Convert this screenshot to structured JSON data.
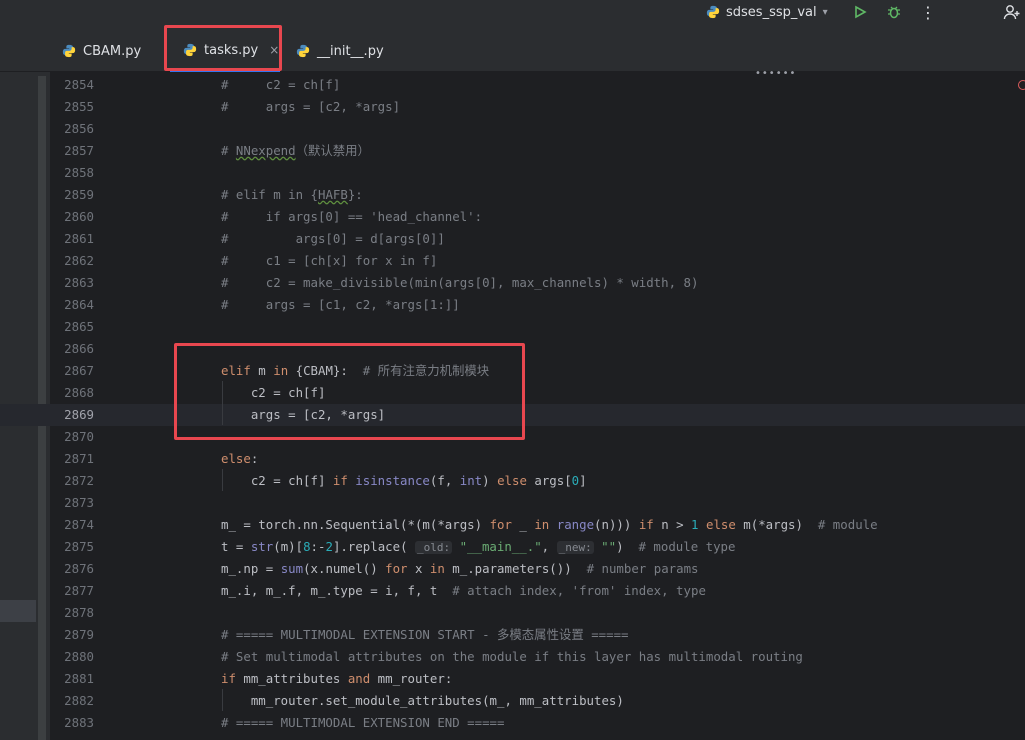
{
  "toolbar": {
    "run_config": "sdses_ssp_val",
    "run_config_chevron": "chevron-down-icon"
  },
  "tabs": [
    {
      "label": "CBAM.py",
      "icon": "python-file-icon"
    },
    {
      "label": "tasks.py",
      "icon": "python-file-icon",
      "active": true,
      "close": "×"
    },
    {
      "label": "__init__.py",
      "icon": "python-file-icon"
    }
  ],
  "editor": {
    "current_line": "2869",
    "lines": [
      {
        "n": "2854",
        "t": "#     c2 = ch[f]"
      },
      {
        "n": "2855",
        "t": "#     args = [c2, *args]"
      },
      {
        "n": "2856",
        "t": ""
      },
      {
        "n": "2857",
        "t": "# NNexpend（默认禁用）"
      },
      {
        "n": "2858",
        "t": ""
      },
      {
        "n": "2859",
        "t": "# elif m in {HAFB}:"
      },
      {
        "n": "2860",
        "t": "#     if args[0] == 'head_channel':"
      },
      {
        "n": "2861",
        "t": "#         args[0] = d[args[0]]"
      },
      {
        "n": "2862",
        "t": "#     c1 = [ch[x] for x in f]"
      },
      {
        "n": "2863",
        "t": "#     c2 = make_divisible(min(args[0], max_channels) * width, 8)"
      },
      {
        "n": "2864",
        "t": "#     args = [c1, c2, *args[1:]]"
      },
      {
        "n": "2865",
        "t": ""
      },
      {
        "n": "2866",
        "t": ""
      },
      {
        "n": "2867",
        "t": "elif m in {CBAM}:  # 所有注意力机制模块"
      },
      {
        "n": "2868",
        "t": "    c2 = ch[f]"
      },
      {
        "n": "2869",
        "t": "    args = [c2, *args]"
      },
      {
        "n": "2870",
        "t": ""
      },
      {
        "n": "2871",
        "t": "else:"
      },
      {
        "n": "2872",
        "t": "    c2 = ch[f] if isinstance(f, int) else args[0]"
      },
      {
        "n": "2873",
        "t": ""
      },
      {
        "n": "2874",
        "t": "m_ = torch.nn.Sequential(*(m(*args) for _ in range(n))) if n > 1 else m(*args)  # module"
      },
      {
        "n": "2875",
        "t": "t = str(m)[8:-2].replace( _old: \"__main__.\", _new: \"\")  # module type"
      },
      {
        "n": "2876",
        "t": "m_.np = sum(x.numel() for x in m_.parameters())  # number params"
      },
      {
        "n": "2877",
        "t": "m_.i, m_.f, m_.type = i, f, t  # attach index, 'from' index, type"
      },
      {
        "n": "2878",
        "t": ""
      },
      {
        "n": "2879",
        "t": "# ===== MULTIMODAL EXTENSION START - 多模态属性设置 ====="
      },
      {
        "n": "2880",
        "t": "# Set multimodal attributes on the module if this layer has multimodal routing"
      },
      {
        "n": "2881",
        "t": "if mm_attributes and mm_router:"
      },
      {
        "n": "2882",
        "t": "    mm_router.set_module_attributes(m_, mm_attributes)"
      },
      {
        "n": "2883",
        "t": "# ===== MULTIMODAL EXTENSION END ====="
      }
    ]
  },
  "colors": {
    "highlight_box": "#e8474f",
    "accent": "#3574f0",
    "keyword": "#cf8e6d",
    "comment": "#7a7e85",
    "number": "#2aacb8",
    "string": "#6aab73"
  }
}
